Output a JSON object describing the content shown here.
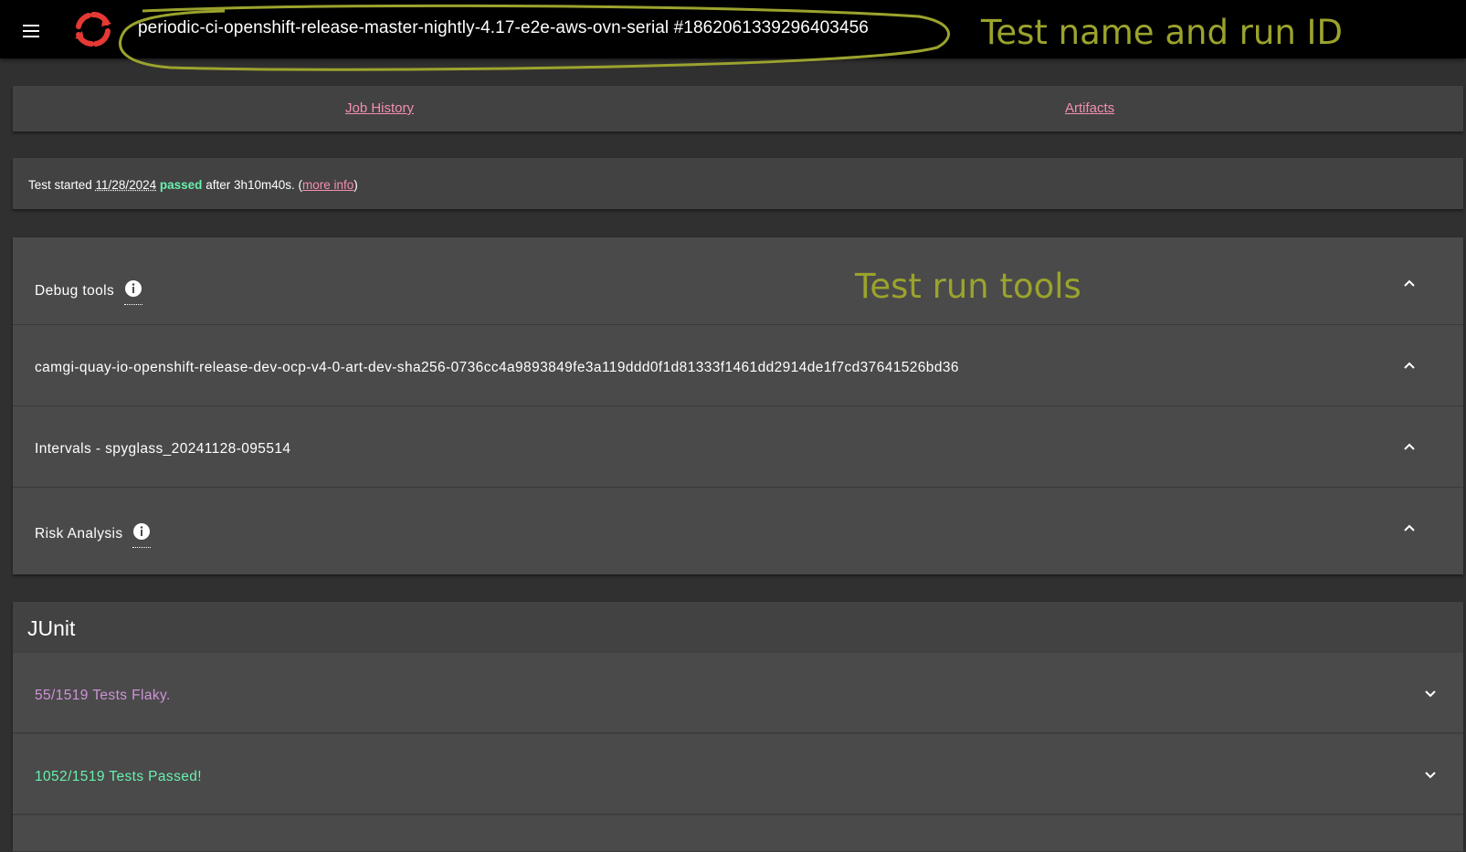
{
  "header": {
    "job_title": "periodic-ci-openshift-release-master-nightly-4.17-e2e-aws-ovn-serial #1862061339296403456",
    "annotation": "Test name and run ID"
  },
  "links": {
    "job_history": "Job History",
    "artifacts": "Artifacts"
  },
  "status": {
    "prefix": "Test started",
    "date": "11/28/2024",
    "result": "passed",
    "duration_text": "after 3h10m40s. (",
    "more_info": "more info",
    "suffix": ")"
  },
  "accordion": {
    "annotation": "Test run tools",
    "items": [
      {
        "label": "Debug tools",
        "has_info": true
      },
      {
        "label": "camgi-quay-io-openshift-release-dev-ocp-v4-0-art-dev-sha256-0736cc4a9893849fe3a119ddd0f1d81333f1461dd2914de1f7cd37641526bd36",
        "has_info": false
      },
      {
        "label": "Intervals - spyglass_20241128-095514",
        "has_info": false
      },
      {
        "label": "Risk Analysis",
        "has_info": true
      }
    ]
  },
  "junit": {
    "title": "JUnit",
    "flaky": "55/1519 Tests Flaky.",
    "passed": "1052/1519 Tests Passed!"
  },
  "colors": {
    "accent_link": "#f48fb1",
    "passed_green": "#69f0ae",
    "flaky_purple": "#ce93d8",
    "annotation": "#9ba32d",
    "logo_red": "#e53935"
  },
  "icons": [
    "menu-icon",
    "openshift-ci-logo",
    "info-icon",
    "chevron-up-icon",
    "chevron-down-icon"
  ]
}
